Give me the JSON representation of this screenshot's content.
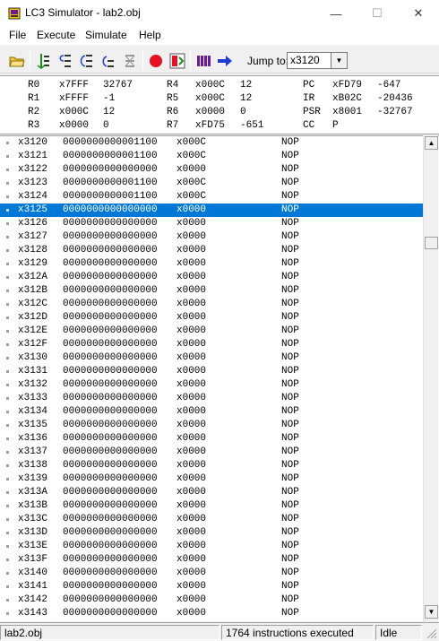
{
  "window": {
    "title": "LC3 Simulator - lab2.obj",
    "minimize_glyph": "—",
    "maximize_glyph": "☐",
    "close_glyph": "✕"
  },
  "menu": [
    "File",
    "Execute",
    "Simulate",
    "Help"
  ],
  "toolbar": {
    "buttons": [
      {
        "name": "open-file-button",
        "icon": "folder-icon"
      },
      {
        "name": "run-button",
        "icon": "run-icon"
      },
      {
        "name": "step-over-button",
        "icon": "step-over-icon"
      },
      {
        "name": "step-into-button",
        "icon": "step-into-icon"
      },
      {
        "name": "step-out-button",
        "icon": "step-out-icon"
      },
      {
        "name": "stop-button",
        "icon": "stop-icon"
      },
      {
        "name": "toggle-breakpoint-button",
        "icon": "breakpoint-icon"
      },
      {
        "name": "clear-breakpoints-button",
        "icon": "clear-breakpoints-icon"
      },
      {
        "name": "memory-view-button",
        "icon": "memory-icon"
      },
      {
        "name": "jump-to-pc-button",
        "icon": "arrow-right-icon"
      }
    ],
    "jump_label": "Jump to:",
    "jump_value": "x3120",
    "colors": {
      "stop_red": "#e81123",
      "arrow_blue": "#1e3cd2",
      "step_green": "#1a8f1a",
      "mem_purple": "#6a1b9a"
    }
  },
  "registers": [
    [
      [
        "R0",
        "x7FFF",
        "32767"
      ],
      [
        "R4",
        "x000C",
        "12"
      ],
      [
        "PC",
        "xFD79",
        "-647"
      ]
    ],
    [
      [
        "R1",
        "xFFFF",
        "-1"
      ],
      [
        "R5",
        "x000C",
        "12"
      ],
      [
        "IR",
        "xB02C",
        "-20436"
      ]
    ],
    [
      [
        "R2",
        "x000C",
        "12"
      ],
      [
        "R6",
        "x0000",
        "0"
      ],
      [
        "PSR",
        "x8001",
        "-32767"
      ]
    ],
    [
      [
        "R3",
        "x0000",
        "0"
      ],
      [
        "R7",
        "xFD75",
        "-651"
      ],
      [
        "CC",
        "P",
        ""
      ]
    ]
  ],
  "memory": [
    [
      "x3120",
      "0000000000001100",
      "x000C",
      "NOP"
    ],
    [
      "x3121",
      "0000000000001100",
      "x000C",
      "NOP"
    ],
    [
      "x3122",
      "0000000000000000",
      "x0000",
      "NOP"
    ],
    [
      "x3123",
      "0000000000001100",
      "x000C",
      "NOP"
    ],
    [
      "x3124",
      "0000000000001100",
      "x000C",
      "NOP"
    ],
    [
      "x3125",
      "0000000000000000",
      "x0000",
      "NOP"
    ],
    [
      "x3126",
      "0000000000000000",
      "x0000",
      "NOP"
    ],
    [
      "x3127",
      "0000000000000000",
      "x0000",
      "NOP"
    ],
    [
      "x3128",
      "0000000000000000",
      "x0000",
      "NOP"
    ],
    [
      "x3129",
      "0000000000000000",
      "x0000",
      "NOP"
    ],
    [
      "x312A",
      "0000000000000000",
      "x0000",
      "NOP"
    ],
    [
      "x312B",
      "0000000000000000",
      "x0000",
      "NOP"
    ],
    [
      "x312C",
      "0000000000000000",
      "x0000",
      "NOP"
    ],
    [
      "x312D",
      "0000000000000000",
      "x0000",
      "NOP"
    ],
    [
      "x312E",
      "0000000000000000",
      "x0000",
      "NOP"
    ],
    [
      "x312F",
      "0000000000000000",
      "x0000",
      "NOP"
    ],
    [
      "x3130",
      "0000000000000000",
      "x0000",
      "NOP"
    ],
    [
      "x3131",
      "0000000000000000",
      "x0000",
      "NOP"
    ],
    [
      "x3132",
      "0000000000000000",
      "x0000",
      "NOP"
    ],
    [
      "x3133",
      "0000000000000000",
      "x0000",
      "NOP"
    ],
    [
      "x3134",
      "0000000000000000",
      "x0000",
      "NOP"
    ],
    [
      "x3135",
      "0000000000000000",
      "x0000",
      "NOP"
    ],
    [
      "x3136",
      "0000000000000000",
      "x0000",
      "NOP"
    ],
    [
      "x3137",
      "0000000000000000",
      "x0000",
      "NOP"
    ],
    [
      "x3138",
      "0000000000000000",
      "x0000",
      "NOP"
    ],
    [
      "x3139",
      "0000000000000000",
      "x0000",
      "NOP"
    ],
    [
      "x313A",
      "0000000000000000",
      "x0000",
      "NOP"
    ],
    [
      "x313B",
      "0000000000000000",
      "x0000",
      "NOP"
    ],
    [
      "x313C",
      "0000000000000000",
      "x0000",
      "NOP"
    ],
    [
      "x313D",
      "0000000000000000",
      "x0000",
      "NOP"
    ],
    [
      "x313E",
      "0000000000000000",
      "x0000",
      "NOP"
    ],
    [
      "x313F",
      "0000000000000000",
      "x0000",
      "NOP"
    ],
    [
      "x3140",
      "0000000000000000",
      "x0000",
      "NOP"
    ],
    [
      "x3141",
      "0000000000000000",
      "x0000",
      "NOP"
    ],
    [
      "x3142",
      "0000000000000000",
      "x0000",
      "NOP"
    ],
    [
      "x3143",
      "0000000000000000",
      "x0000",
      "NOP"
    ]
  ],
  "selected_address": "x3125",
  "selection_color": "#0078d7",
  "status": {
    "file": "lab2.obj",
    "instructions": "1764 instructions executed",
    "state": "Idle"
  }
}
